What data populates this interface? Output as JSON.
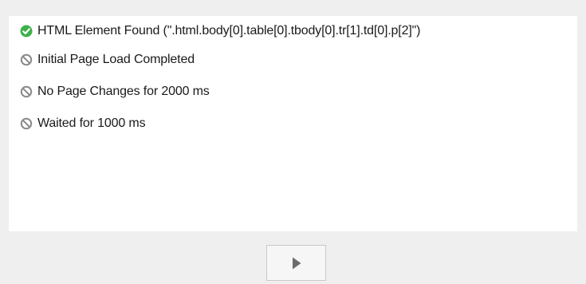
{
  "conditions": [
    {
      "label": "HTML Element Found (\".html.body[0].table[0].tbody[0].tr[1].td[0].p[2]\")",
      "status": "met",
      "icon": "check-circle-icon"
    },
    {
      "label": "Initial Page Load Completed",
      "status": "inactive",
      "icon": "disabled-circle-icon"
    },
    {
      "label": "No Page Changes for 2000 ms",
      "status": "inactive",
      "icon": "disabled-circle-icon"
    },
    {
      "label": "Waited for 1000 ms",
      "status": "inactive",
      "icon": "disabled-circle-icon"
    }
  ],
  "colors": {
    "met": "#3db04a",
    "inactive": "#8a8a8a",
    "play": "#6c6c6c"
  },
  "play_button": {
    "icon": "play-icon"
  }
}
